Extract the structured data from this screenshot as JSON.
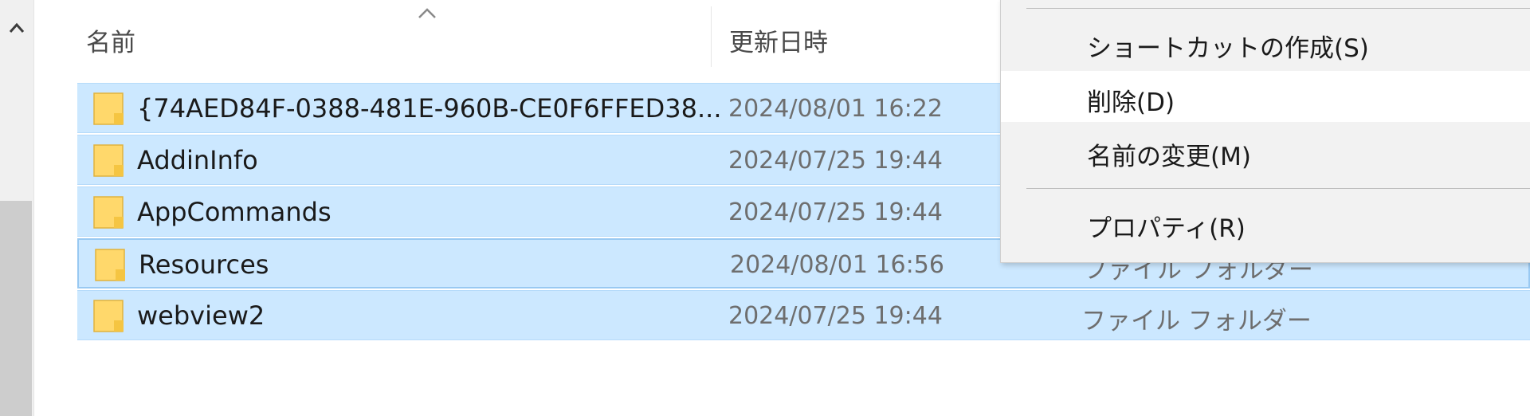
{
  "columns": {
    "name": "名前",
    "modified": "更新日時"
  },
  "files": [
    {
      "name": "{74AED84F-0388-481E-960B-CE0F6FFED38...",
      "modified": "2024/08/01 16:22",
      "type": ""
    },
    {
      "name": "AddinInfo",
      "modified": "2024/07/25 19:44",
      "type": ""
    },
    {
      "name": "AppCommands",
      "modified": "2024/07/25 19:44",
      "type": ""
    },
    {
      "name": "Resources",
      "modified": "2024/08/01 16:56",
      "type": "ファイル フォルダー"
    },
    {
      "name": "webview2",
      "modified": "2024/07/25 19:44",
      "type": "ファイル フォルダー"
    }
  ],
  "context_menu": {
    "items": [
      {
        "label": "ショートカットの作成(S)"
      },
      {
        "label": "削除(D)"
      },
      {
        "label": "名前の変更(M)"
      },
      {
        "label": "プロパティ(R)"
      }
    ]
  },
  "colors": {
    "selection": "#cce8ff",
    "selection_border": "#99c9f2",
    "folder": "#ffd86b",
    "menu_background": "#f2f2f2"
  },
  "icons": {
    "scroll_up": "chevron-up-icon",
    "sort": "sort-ascending-icon",
    "folder": "folder-icon"
  }
}
